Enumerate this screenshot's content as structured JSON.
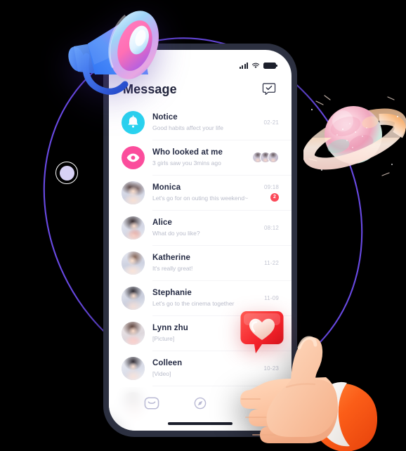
{
  "scene": {
    "background": "#000000",
    "accent_purple": "#6f5bf0",
    "phone_frame_color": "#2c3040"
  },
  "phone": {
    "status_bar": {
      "signal_icon": "signal-bars-icon",
      "wifi_icon": "wifi-icon",
      "battery_icon": "battery-full-icon"
    },
    "header": {
      "title": "Message",
      "action_icon": "compose-check-bubble-icon"
    },
    "messages": [
      {
        "avatar_type": "icon",
        "avatar_icon": "bell-icon",
        "avatar_color": "#2ad2ef",
        "name": "Notice",
        "preview": "Good habits affect your life",
        "time": "02-21",
        "badge": "",
        "viewers": 0
      },
      {
        "avatar_type": "icon",
        "avatar_icon": "eye-icon",
        "avatar_color": "#fb4d9c",
        "name": "Who looked at me",
        "preview": "3 girls saw you 3mins ago",
        "time": "",
        "badge": "",
        "viewers": 3
      },
      {
        "avatar_type": "photo",
        "avatar_icon": "avatar-photo",
        "avatar_color": "",
        "name": "Monica",
        "preview": "Let's go for on outing this weekend~",
        "time": "09:18",
        "badge": "2",
        "viewers": 0
      },
      {
        "avatar_type": "photo",
        "avatar_icon": "avatar-photo",
        "avatar_color": "",
        "name": "Alice",
        "preview": "What do you like?",
        "time": "08:12",
        "badge": "",
        "viewers": 0
      },
      {
        "avatar_type": "photo",
        "avatar_icon": "avatar-photo",
        "avatar_color": "",
        "name": "Katherine",
        "preview": "It's really  great!",
        "time": "11-22",
        "badge": "",
        "viewers": 0
      },
      {
        "avatar_type": "photo",
        "avatar_icon": "avatar-photo",
        "avatar_color": "",
        "name": "Stephanie",
        "preview": "Let's go to the cinema together",
        "time": "11-09",
        "badge": "",
        "viewers": 0
      },
      {
        "avatar_type": "photo",
        "avatar_icon": "avatar-photo",
        "avatar_color": "",
        "name": "Lynn zhu",
        "preview": "[Picture]",
        "time": "",
        "badge": "",
        "viewers": 0
      },
      {
        "avatar_type": "photo",
        "avatar_icon": "avatar-photo",
        "avatar_color": "",
        "name": "Colleen",
        "preview": "[Video]",
        "time": "10-23",
        "badge": "",
        "viewers": 0
      }
    ],
    "tabbar": {
      "items": [
        {
          "icon": "mail-envelope-icon",
          "active": false
        },
        {
          "icon": "compass-discover-icon",
          "active": false
        },
        {
          "icon": "chat-bubble-icon",
          "active": true
        }
      ],
      "active_color": "#7c5cf5"
    }
  },
  "decorations": {
    "megaphone": "megaphone-3d-icon",
    "planet": "planet-ringed-3d-icon",
    "heart_sticker": "heart-like-bubble-icon",
    "thumbs_up": "thumbs-up-hand-3d-icon",
    "orbit_node": "orbit-dot-icon",
    "orbit_line": "orbit-curve"
  }
}
